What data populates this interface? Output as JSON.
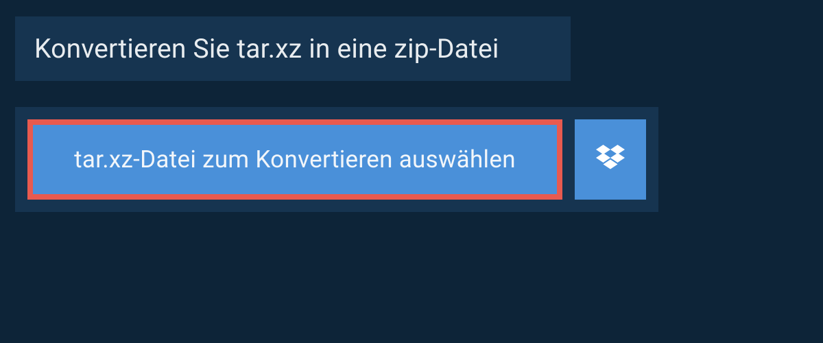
{
  "heading": {
    "title": "Konvertieren Sie tar.xz in eine zip-Datei"
  },
  "upload": {
    "select_button_label": "tar.xz-Datei zum Konvertieren auswählen"
  },
  "colors": {
    "background": "#0d2438",
    "panel": "#163450",
    "button_bg": "#4a90d9",
    "button_border": "#e85a4f",
    "text_light": "#e8ecef"
  },
  "icons": {
    "dropbox": "dropbox-icon"
  }
}
